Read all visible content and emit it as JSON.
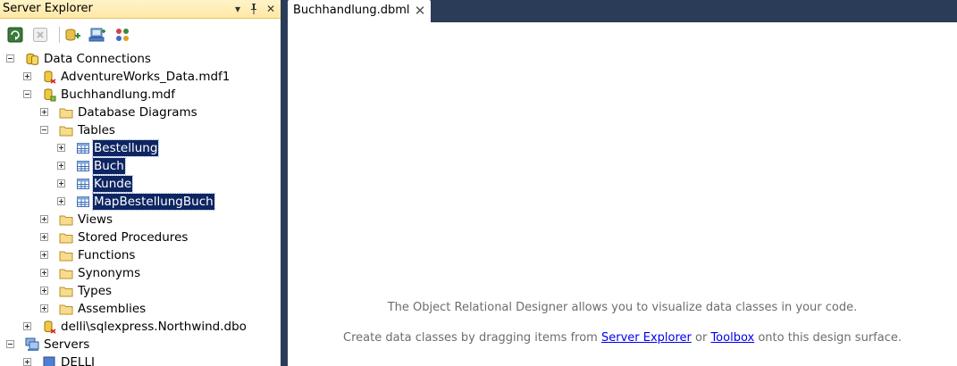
{
  "server_explorer": {
    "title": "Server Explorer",
    "title_buttons": {
      "dropdown": "▾",
      "pin": "🖈",
      "close": "✕"
    },
    "toolbar": [
      "refresh-icon",
      "stop-refresh-icon",
      "connect-database-icon",
      "connect-server-icon",
      "sharepoint-icon"
    ],
    "tree": {
      "data_connections": "Data Connections",
      "adventureworks": "AdventureWorks_Data.mdf1",
      "buchhandlung": "Buchhandlung.mdf",
      "database_diagrams": "Database Diagrams",
      "tables": "Tables",
      "table_items": [
        "Bestellung",
        "Buch",
        "Kunde",
        "MapBestellungBuch"
      ],
      "views": "Views",
      "stored_procedures": "Stored Procedures",
      "functions": "Functions",
      "synonyms": "Synonyms",
      "types": "Types",
      "assemblies": "Assemblies",
      "northwind": "delli\\sqlexpress.Northwind.dbo",
      "servers": "Servers",
      "server_delli": "DELLI"
    }
  },
  "document": {
    "tab_label": "Buchhandlung.dbml",
    "tab_close": "✕",
    "hint_line1": "The Object Relational Designer allows you to visualize data classes in your code.",
    "hint_line2": {
      "prefix": "Create data classes by dragging items from ",
      "link1": "Server Explorer",
      "middle": " or ",
      "link2": "Toolbox",
      "suffix": " onto this design surface."
    }
  },
  "colors": {
    "title_bar": "#ffe8a6",
    "selection": "#0d2561",
    "workspace": "#2b3c59",
    "hint_text": "#6d6d6d",
    "link": "#0000ee"
  }
}
